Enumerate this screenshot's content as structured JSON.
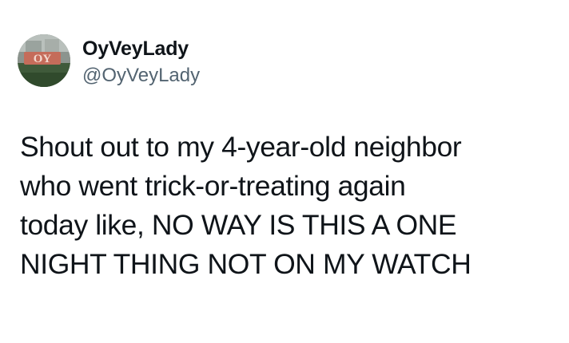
{
  "tweet": {
    "author": {
      "display_name": "OyVeyLady",
      "handle": "@OyVeyLady",
      "avatar_icon": "profile-avatar-photo",
      "avatar_text": "OY"
    },
    "text": "Shout out to my 4-year-old neighbor\nwho went trick-or-treating again\ntoday like, NO WAY IS THIS A ONE\nNIGHT THING NOT ON MY WATCH"
  },
  "colors": {
    "background": "#ffffff",
    "primary_text": "#0f1419",
    "secondary_text": "#536471"
  }
}
